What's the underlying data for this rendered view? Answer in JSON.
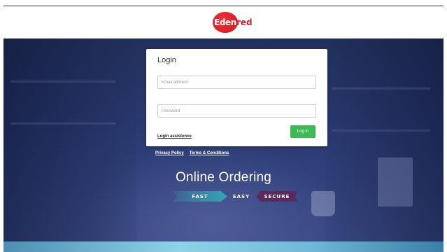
{
  "brand": {
    "name": "Edenred",
    "logo_part1": "Eden",
    "logo_part2": "red",
    "color": "#d81e26"
  },
  "login": {
    "title": "Login",
    "email_placeholder": "Email address",
    "password_placeholder": "Password",
    "assistance_link": "Login assistence",
    "submit_label": "Log in",
    "submit_color": "#3dba55"
  },
  "footer_links": {
    "privacy": "Privacy Policy",
    "terms": "Terms & Conditions"
  },
  "hero": {
    "tagline": "Online Ordering",
    "badges": {
      "fast": "FAST",
      "easy": "EASY",
      "secure": "SECURE"
    }
  },
  "icons": {
    "logo": "edenred-logo-icon"
  }
}
